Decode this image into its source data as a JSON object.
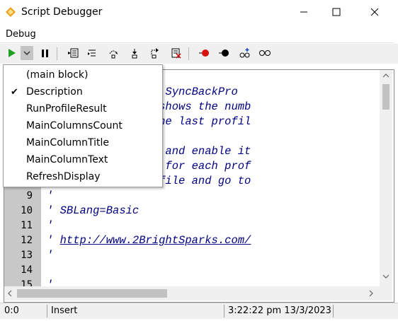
{
  "window": {
    "title": "Script Debugger"
  },
  "menu": {
    "debug": "Debug"
  },
  "toolbar": {
    "buttons": [
      "run-icon",
      "dropdown-arrow-icon",
      "pause-icon",
      "compile-icon",
      "step-into-icon",
      "step-over-icon",
      "step-out-icon",
      "run-to-cursor-icon",
      "reset-icon",
      "toggle-breakpoint-icon",
      "clear-breakpoints-icon",
      "add-watch-icon",
      "watches-icon"
    ]
  },
  "dropdown": {
    "items": [
      {
        "label": "(main block)",
        "checked": false
      },
      {
        "label": "Description",
        "checked": true
      },
      {
        "label": "RunProfileResult",
        "checked": false
      },
      {
        "label": "MainColumnsCount",
        "checked": false
      },
      {
        "label": "MainColumnTitle",
        "checked": false
      },
      {
        "label": "MainColumnText",
        "checked": false
      },
      {
        "label": "RefreshDisplay",
        "checked": false
      }
    ],
    "check_mark": "✔"
  },
  "editor": {
    "visible_code": [
      {
        "ln": "",
        "text": "for 2BrightSparks SyncBackPro"
      },
      {
        "ln": "",
        "text": "main window that shows the numb"
      },
      {
        "ln": "",
        "text": "eleted, etc. in the last profil"
      },
      {
        "ln": "",
        "text": ""
      },
      {
        "ln": "",
        "text": "stall this script and enable it"
      },
      {
        "ln": "",
        "text": "need to enlllable for each prof"
      },
      {
        "ln": "",
        "text": "n (modify the profile and go to"
      },
      {
        "ln": "9",
        "text": "'"
      },
      {
        "ln": "10",
        "text": "' SBLang=Basic"
      },
      {
        "ln": "11",
        "text": "'"
      },
      {
        "ln": "12",
        "text": "' "
      },
      {
        "ln": "13",
        "text": "'"
      },
      {
        "ln": "14",
        "text": ""
      },
      {
        "ln": "15",
        "text": "'"
      }
    ],
    "link": "http://www.2BrightSparks.com/"
  },
  "status": {
    "position": "0:0",
    "mode": "Insert",
    "datetime": "3:22:22 pm 13/3/2023"
  }
}
